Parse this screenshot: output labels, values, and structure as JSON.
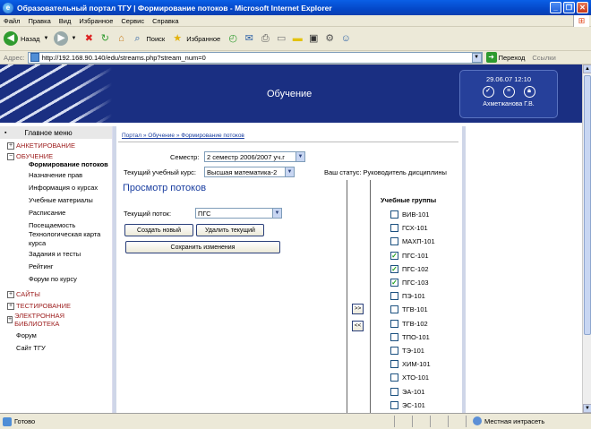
{
  "window": {
    "title": "Образовательный портал ТГУ | Формирование потоков - Microsoft Internet Explorer"
  },
  "menu": [
    "Файл",
    "Правка",
    "Вид",
    "Избранное",
    "Сервис",
    "Справка"
  ],
  "toolbar": {
    "back": "Назад",
    "search": "Поиск",
    "favorites": "Избранное"
  },
  "address": {
    "label": "Адрес:",
    "url": "http://192.168.90.140/edu/streams.php?stream_num=0",
    "go": "Переход",
    "links": "Ссылки"
  },
  "banner": {
    "title": "Обучение",
    "datetime": "29.06.07 12:10",
    "user": "Ахметжанова Г.В."
  },
  "sidebar": {
    "header": "Главное меню",
    "cat_survey": "АНКЕТИРОВАНИЕ",
    "cat_learning": "ОБУЧЕНИЕ",
    "items": [
      "Формирование потоков",
      "Назначение прав",
      "Информация о курсах",
      "Учебные материалы",
      "Расписание",
      "Посещаемость",
      "Технологическая карта курса",
      "Задания и тесты",
      "Рейтинг",
      "Форум по курсу"
    ],
    "cat_sites": "САЙТЫ",
    "cat_testing": "ТЕСТИРОВАНИЕ",
    "cat_library": "ЭЛЕКТРОННАЯ БИБЛИОТЕКА",
    "forum": "Форум",
    "site": "Сайт ТГУ"
  },
  "breadcrumb": "Портал » Обучение » Формирование потоков",
  "form": {
    "semester_label": "Семестр:",
    "semester_value": "2 семестр 2006/2007 уч.г",
    "course_label": "Текущий учебный курс:",
    "course_value": "Высшая математика-2",
    "status": "Ваш статус: Руководитель дисциплины",
    "heading": "Просмотр потоков",
    "stream_label": "Текущий поток:",
    "stream_value": "ПГС",
    "create": "Создать новый",
    "delete": "Удалить текущий",
    "save": "Сохранить изменения",
    "move_right": ">>",
    "move_left": "<<"
  },
  "groups": {
    "header": "Учебные группы",
    "list": [
      {
        "name": "ВИВ-101",
        "checked": false
      },
      {
        "name": "ГСХ-101",
        "checked": false
      },
      {
        "name": "МАХП-101",
        "checked": false
      },
      {
        "name": "ПГС-101",
        "checked": true
      },
      {
        "name": "ПГС-102",
        "checked": true
      },
      {
        "name": "ПГС-103",
        "checked": true
      },
      {
        "name": "ПЭ-101",
        "checked": false
      },
      {
        "name": "ТГВ-101",
        "checked": false
      },
      {
        "name": "ТГВ-102",
        "checked": false
      },
      {
        "name": "ТПО-101",
        "checked": false
      },
      {
        "name": "ТЭ-101",
        "checked": false
      },
      {
        "name": "ХИМ-101",
        "checked": false
      },
      {
        "name": "ХТО-101",
        "checked": false
      },
      {
        "name": "ЭА-101",
        "checked": false
      },
      {
        "name": "ЭС-101",
        "checked": false
      }
    ]
  },
  "statusbar": {
    "text": "Готово",
    "zone": "Местная интрасеть"
  }
}
